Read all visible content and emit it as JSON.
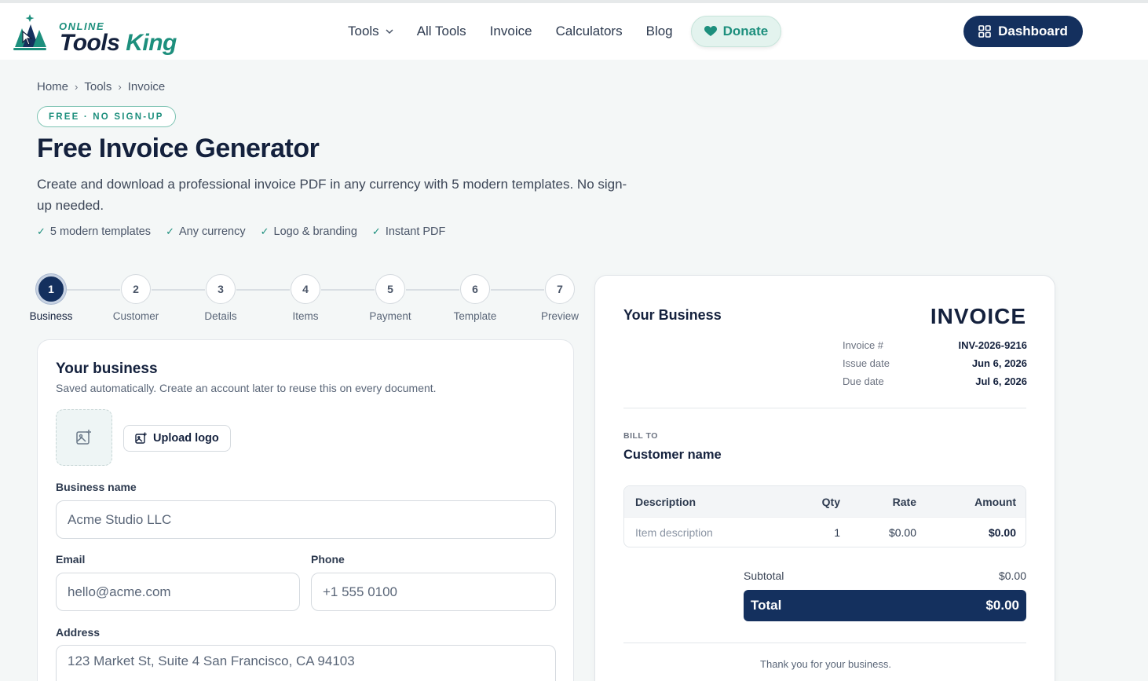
{
  "brand": {
    "tagline": "ONLINE",
    "name_part1": "Tools",
    "name_part2": "King",
    "accent": "#1d8f7d",
    "navy": "#14305e"
  },
  "nav": {
    "tools": "Tools",
    "all_tools": "All Tools",
    "invoice": "Invoice",
    "calculators": "Calculators",
    "blog": "Blog",
    "donate": "Donate",
    "dashboard": "Dashboard"
  },
  "breadcrumb": [
    "Home",
    "Tools",
    "Invoice"
  ],
  "hero": {
    "badge": "FREE · NO SIGN-UP",
    "title": "Free Invoice Generator",
    "lead": "Create and download a professional invoice PDF in any currency with 5 modern templates. No sign-up needed.",
    "features": [
      "5 modern templates",
      "Any currency",
      "Logo & branding",
      "Instant PDF"
    ]
  },
  "steps": [
    {
      "num": "1",
      "label": "Business",
      "active": true
    },
    {
      "num": "2",
      "label": "Customer",
      "active": false
    },
    {
      "num": "3",
      "label": "Details",
      "active": false
    },
    {
      "num": "4",
      "label": "Items",
      "active": false
    },
    {
      "num": "5",
      "label": "Payment",
      "active": false
    },
    {
      "num": "6",
      "label": "Template",
      "active": false
    },
    {
      "num": "7",
      "label": "Preview",
      "active": false
    }
  ],
  "form": {
    "title": "Your business",
    "subtitle": "Saved automatically. Create an account later to reuse this on every document.",
    "upload_label": "Upload logo",
    "business_name_label": "Business name",
    "business_name_placeholder": "Acme Studio LLC",
    "email_label": "Email",
    "email_placeholder": "hello@acme.com",
    "phone_label": "Phone",
    "phone_placeholder": "+1 555 0100",
    "address_label": "Address",
    "address_placeholder": "123 Market St, Suite 4 San Francisco, CA 94103"
  },
  "preview": {
    "business": "Your Business",
    "title": "INVOICE",
    "meta": [
      {
        "key": "Invoice #",
        "value": "INV-2026-9216"
      },
      {
        "key": "Issue date",
        "value": "Jun 6, 2026"
      },
      {
        "key": "Due date",
        "value": "Jul 6, 2026"
      }
    ],
    "bill_to_label": "BILL TO",
    "customer": "Customer name",
    "table_headers": {
      "description": "Description",
      "qty": "Qty",
      "rate": "Rate",
      "amount": "Amount"
    },
    "item": {
      "description": "Item description",
      "qty": "1",
      "rate": "$0.00",
      "amount": "$0.00"
    },
    "subtotal_label": "Subtotal",
    "subtotal_value": "$0.00",
    "total_label": "Total",
    "total_value": "$0.00",
    "thanks": "Thank you for your business."
  }
}
